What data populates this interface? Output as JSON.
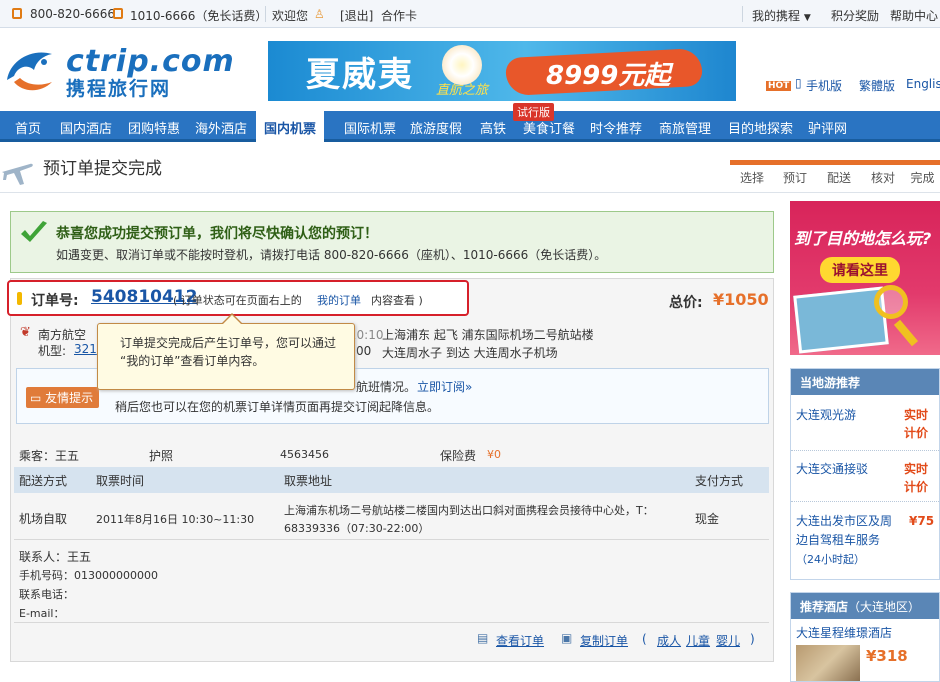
{
  "topbar": {
    "phone1": "800-820-6666",
    "phone2": "1010-6666（免长话费）",
    "welcome": "欢迎您",
    "logout": "[退出]",
    "partner": "合作卡",
    "my_trip": "我的携程",
    "points": "积分奖励",
    "help": "帮助中心"
  },
  "logo": {
    "brand": "ctrip.com",
    "name": "携程旅行网"
  },
  "banner": {
    "title": "夏威夷",
    "subtitle": "直航之旅",
    "price": "8999元起"
  },
  "header_links": {
    "hot": "HOT",
    "mobile": "手机版",
    "traditional": "繁體版",
    "english": "English"
  },
  "nav": {
    "items": [
      "首页",
      "国内酒店",
      "团购特惠",
      "海外酒店",
      "国内机票",
      "国际机票",
      "旅游度假",
      "高铁",
      "美食订餐",
      "时令推荐",
      "商旅管理",
      "目的地探索",
      "驴评网"
    ],
    "active": "国内机票",
    "trial_badge": "试行版"
  },
  "page": {
    "title": "预订单提交完成",
    "steps": [
      "选择",
      "预订",
      "配送",
      "核对",
      "完成"
    ]
  },
  "success": {
    "title": "恭喜您成功提交预订单，我们将尽快确认您的预订！",
    "text": "如遇变更、取消订单或不能按时登机，请拨打电话 800-820-6666（座机）、1010-6666（免长话费）。"
  },
  "order": {
    "label": "订单号:",
    "number": "540810412",
    "hint_pre": "( 订单状态可在页面右上的",
    "hint_link": "我的订单",
    "hint_post": "内容查看 )",
    "total_label": "总价:",
    "total": "¥1050"
  },
  "flight": {
    "airline": "南方航空",
    "model_label": "机型:",
    "model": "321",
    "time_partial": "2011年08月16日 10:10",
    "depart": "上海浦东  起飞  浦东国际机场二号航站楼",
    "arrive_time": "00",
    "arrive": "大连周水子  到达  大连周水子机场"
  },
  "tooltip": {
    "line1": "订单提交完成后产生订单号，您可以通过",
    "line2": "“我的订单”查看订单内容。"
  },
  "notice": {
    "badge": "友情提示",
    "line1": "航班情况。",
    "line1_link": "立即订阅»",
    "line2": "稍后您也可以在您的机票订单详情页面再提交订阅起降信息。"
  },
  "passenger": {
    "label": "乘客：王五",
    "id_type": "护照",
    "id_number": "4563456",
    "insurance_label": "保险费",
    "insurance": "¥0"
  },
  "delivery": {
    "headers": [
      "配送方式",
      "取票时间",
      "取票地址",
      "支付方式"
    ],
    "method": "机场自取",
    "time": "2011年8月16日 10:30~11:30",
    "address_line1": "上海浦东机场二号航站楼二楼国内到达出口斜对面携程会员接待中心处，T：",
    "address_line2": "68339336（07:30-22:00）",
    "payment": "现金"
  },
  "contact": {
    "name": "联系人：王五",
    "mobile": "手机号码：013000000000",
    "phone": "联系电话：",
    "email": "E-mail："
  },
  "actions": {
    "view": "查看订单",
    "copy": "复制订单",
    "bracket_open": "(",
    "adult": "成人",
    "child": "儿童",
    "infant": "婴儿",
    "bracket_close": ")"
  },
  "ad": {
    "title": "到了目的地怎么玩?",
    "button": "请看这里"
  },
  "local": {
    "title": "当地游推荐",
    "items": [
      {
        "name": "大连观光游",
        "price": "实时计价"
      },
      {
        "name": "大连交通接驳",
        "price": "实时计价"
      },
      {
        "name": "大连出发市区及周边自驾租车服务",
        "sub": "（24小时起）",
        "price": "¥75"
      }
    ]
  },
  "hotel": {
    "title": "推荐酒店",
    "region": "（大连地区）",
    "name": "大连星程维璟酒店",
    "price": "¥318"
  },
  "colors": {
    "nav": "#2a74c2",
    "orange": "#e6702a",
    "red": "#d6202a",
    "price": "#e24b1a"
  }
}
